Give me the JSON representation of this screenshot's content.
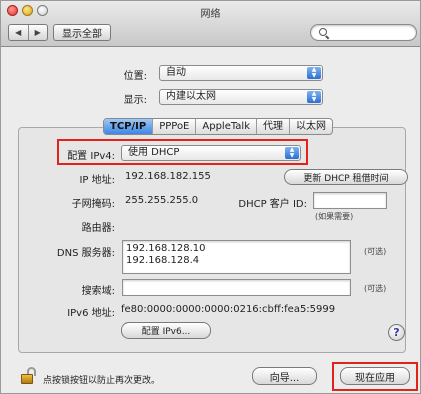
{
  "window": {
    "title": "网络"
  },
  "toolbar": {
    "back_glyph": "◀",
    "forward_glyph": "▶",
    "show_all": "显示全部",
    "search_placeholder": ""
  },
  "location": {
    "label": "位置:",
    "value": "自动"
  },
  "show": {
    "label": "显示:",
    "value": "内建以太网"
  },
  "tabs": [
    "TCP/IP",
    "PPPoE",
    "AppleTalk",
    "代理",
    "以太网"
  ],
  "active_tab": "TCP/IP",
  "config_ipv4": {
    "label": "配置 IPv4:",
    "value": "使用 DHCP"
  },
  "ip": {
    "label": "IP 地址:",
    "value": "192.168.182.155",
    "renew_button": "更新 DHCP 租借时间"
  },
  "subnet": {
    "label": "子网掩码:",
    "value": "255.255.255.0"
  },
  "dhcp_client": {
    "label": "DHCP 客户 ID:",
    "value": "",
    "hint": "(如果需要)"
  },
  "router": {
    "label": "路由器:",
    "value": ""
  },
  "dns": {
    "label": "DNS 服务器:",
    "values": [
      "192.168.128.10",
      "192.168.128.4"
    ],
    "hint": "(可选)"
  },
  "search_domains": {
    "label": "搜索域:",
    "value": "",
    "hint": "(可选)"
  },
  "ipv6": {
    "label": "IPv6 地址:",
    "value": "fe80:0000:0000:0000:0216:cbff:fea5:5999",
    "button": "配置 IPv6..."
  },
  "help_glyph": "?",
  "footer": {
    "lock_text": "点按锁按钮以防止再次更改。",
    "assist_button": "向导...",
    "apply_button": "现在应用"
  },
  "colors": {
    "highlight": "#e2231a",
    "accent": "#3d86e3"
  }
}
